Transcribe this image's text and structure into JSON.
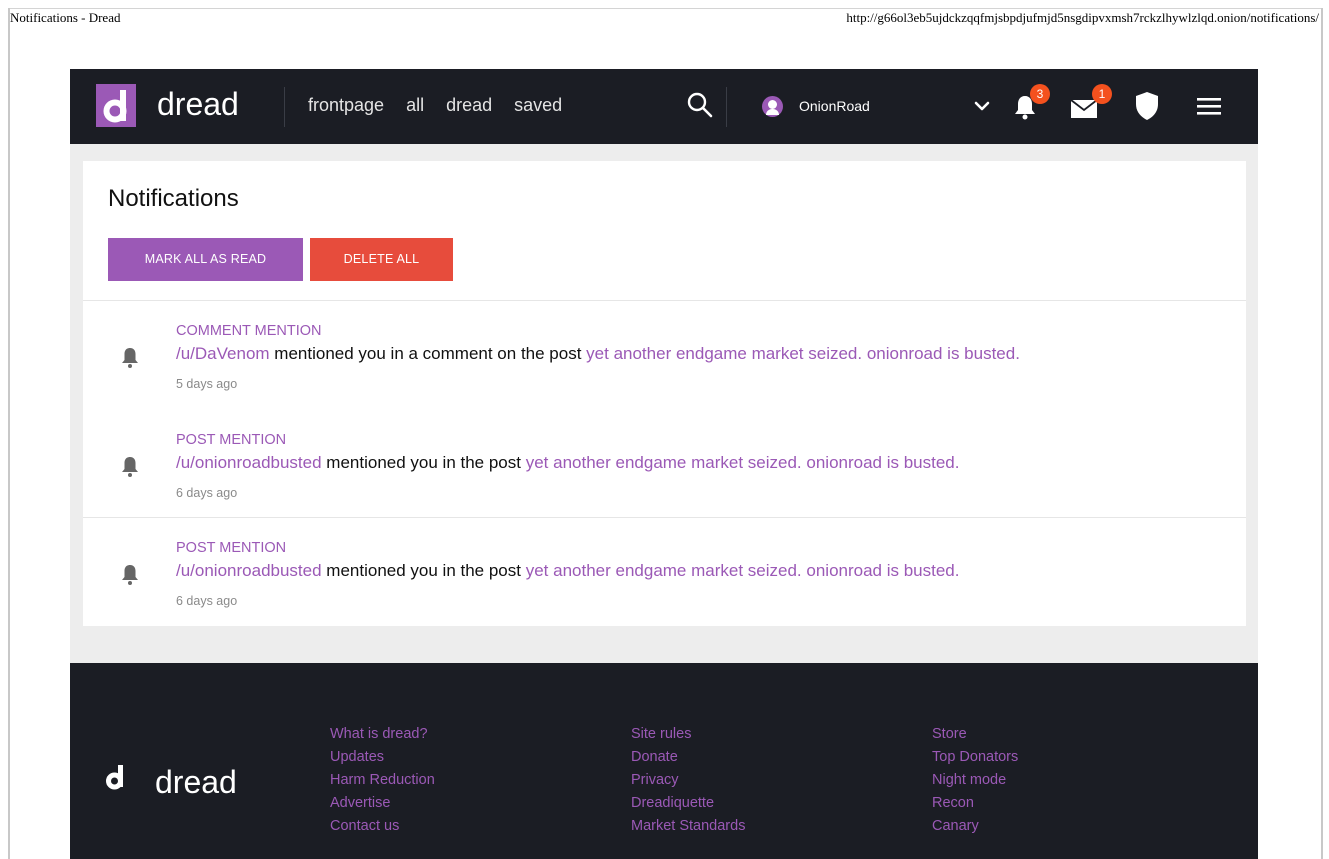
{
  "print_header": {
    "title": "Notifications - Dread",
    "url": "http://g66ol3eb5ujdckzqqfmjsbpdjufmjd5nsgdipvxmsh7rckzlhywlzlqd.onion/notifications/"
  },
  "navbar": {
    "brand": "dread",
    "links": [
      "frontpage",
      "all",
      "dread",
      "saved"
    ],
    "username": "OnionRoad",
    "notifications_count": "3",
    "messages_count": "1"
  },
  "page": {
    "title": "Notifications",
    "mark_all_label": "MARK ALL AS READ",
    "delete_all_label": "DELETE ALL"
  },
  "notifications": [
    {
      "type": "COMMENT MENTION",
      "user": "/u/DaVenom",
      "text": "mentioned you in a comment on the post",
      "post": "yet another endgame market seized. onionroad is busted.",
      "time": "5 days ago"
    },
    {
      "type": "POST MENTION",
      "user": "/u/onionroadbusted",
      "text": "mentioned you in the post",
      "post": "yet another endgame market seized. onionroad is busted.",
      "time": "6 days ago"
    },
    {
      "type": "POST MENTION",
      "user": "/u/onionroadbusted",
      "text": "mentioned you in the post",
      "post": "yet another endgame market seized. onionroad is busted.",
      "time": "6 days ago"
    }
  ],
  "footer": {
    "brand": "dread",
    "col1": [
      "What is dread?",
      "Updates",
      "Harm Reduction",
      "Advertise",
      "Contact us"
    ],
    "col2": [
      "Site rules",
      "Donate",
      "Privacy",
      "Dreadiquette",
      "Market Standards"
    ],
    "col3": [
      "Store",
      "Top Donators",
      "Night mode",
      "Recon",
      "Canary"
    ]
  },
  "colors": {
    "accent": "#9b59b6",
    "danger": "#e74c3c",
    "navbar": "#1b1d24",
    "badge": "#f4511e"
  }
}
